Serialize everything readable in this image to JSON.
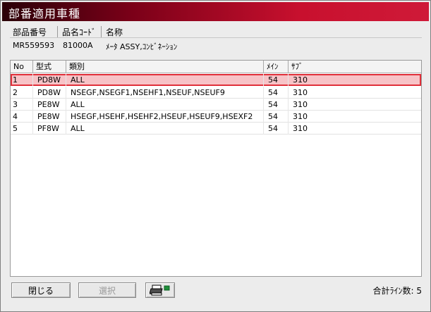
{
  "window": {
    "title": "部番適用車種"
  },
  "info": {
    "headers": [
      "部品番号",
      "品名ｺｰﾄﾞ",
      "名称"
    ],
    "values": [
      "MR559593",
      "81000A",
      "ﾒｰﾀ ASSY,ｺﾝﾋﾞﾈｰｼｮﾝ"
    ]
  },
  "grid": {
    "headers": [
      "No",
      "型式",
      "類別",
      "ﾒｲﾝ",
      "ｻﾌﾞ"
    ],
    "rows": [
      {
        "no": "1",
        "model": "PD8W",
        "class": "ALL",
        "main": "54",
        "sub": "310"
      },
      {
        "no": "2",
        "model": "PD8W",
        "class": "NSEGF,NSEGF1,NSEHF1,NSEUF,NSEUF9",
        "main": "54",
        "sub": "310"
      },
      {
        "no": "3",
        "model": "PE8W",
        "class": "ALL",
        "main": "54",
        "sub": "310"
      },
      {
        "no": "4",
        "model": "PE8W",
        "class": "HSEGF,HSEHF,HSEHF2,HSEUF,HSEUF9,HSEXF2",
        "main": "54",
        "sub": "310"
      },
      {
        "no": "5",
        "model": "PF8W",
        "class": "ALL",
        "main": "54",
        "sub": "310"
      }
    ]
  },
  "buttons": {
    "close": "閉じる",
    "select": "選択"
  },
  "status": {
    "total_label": "合計ﾗｲﾝ数: 5"
  }
}
